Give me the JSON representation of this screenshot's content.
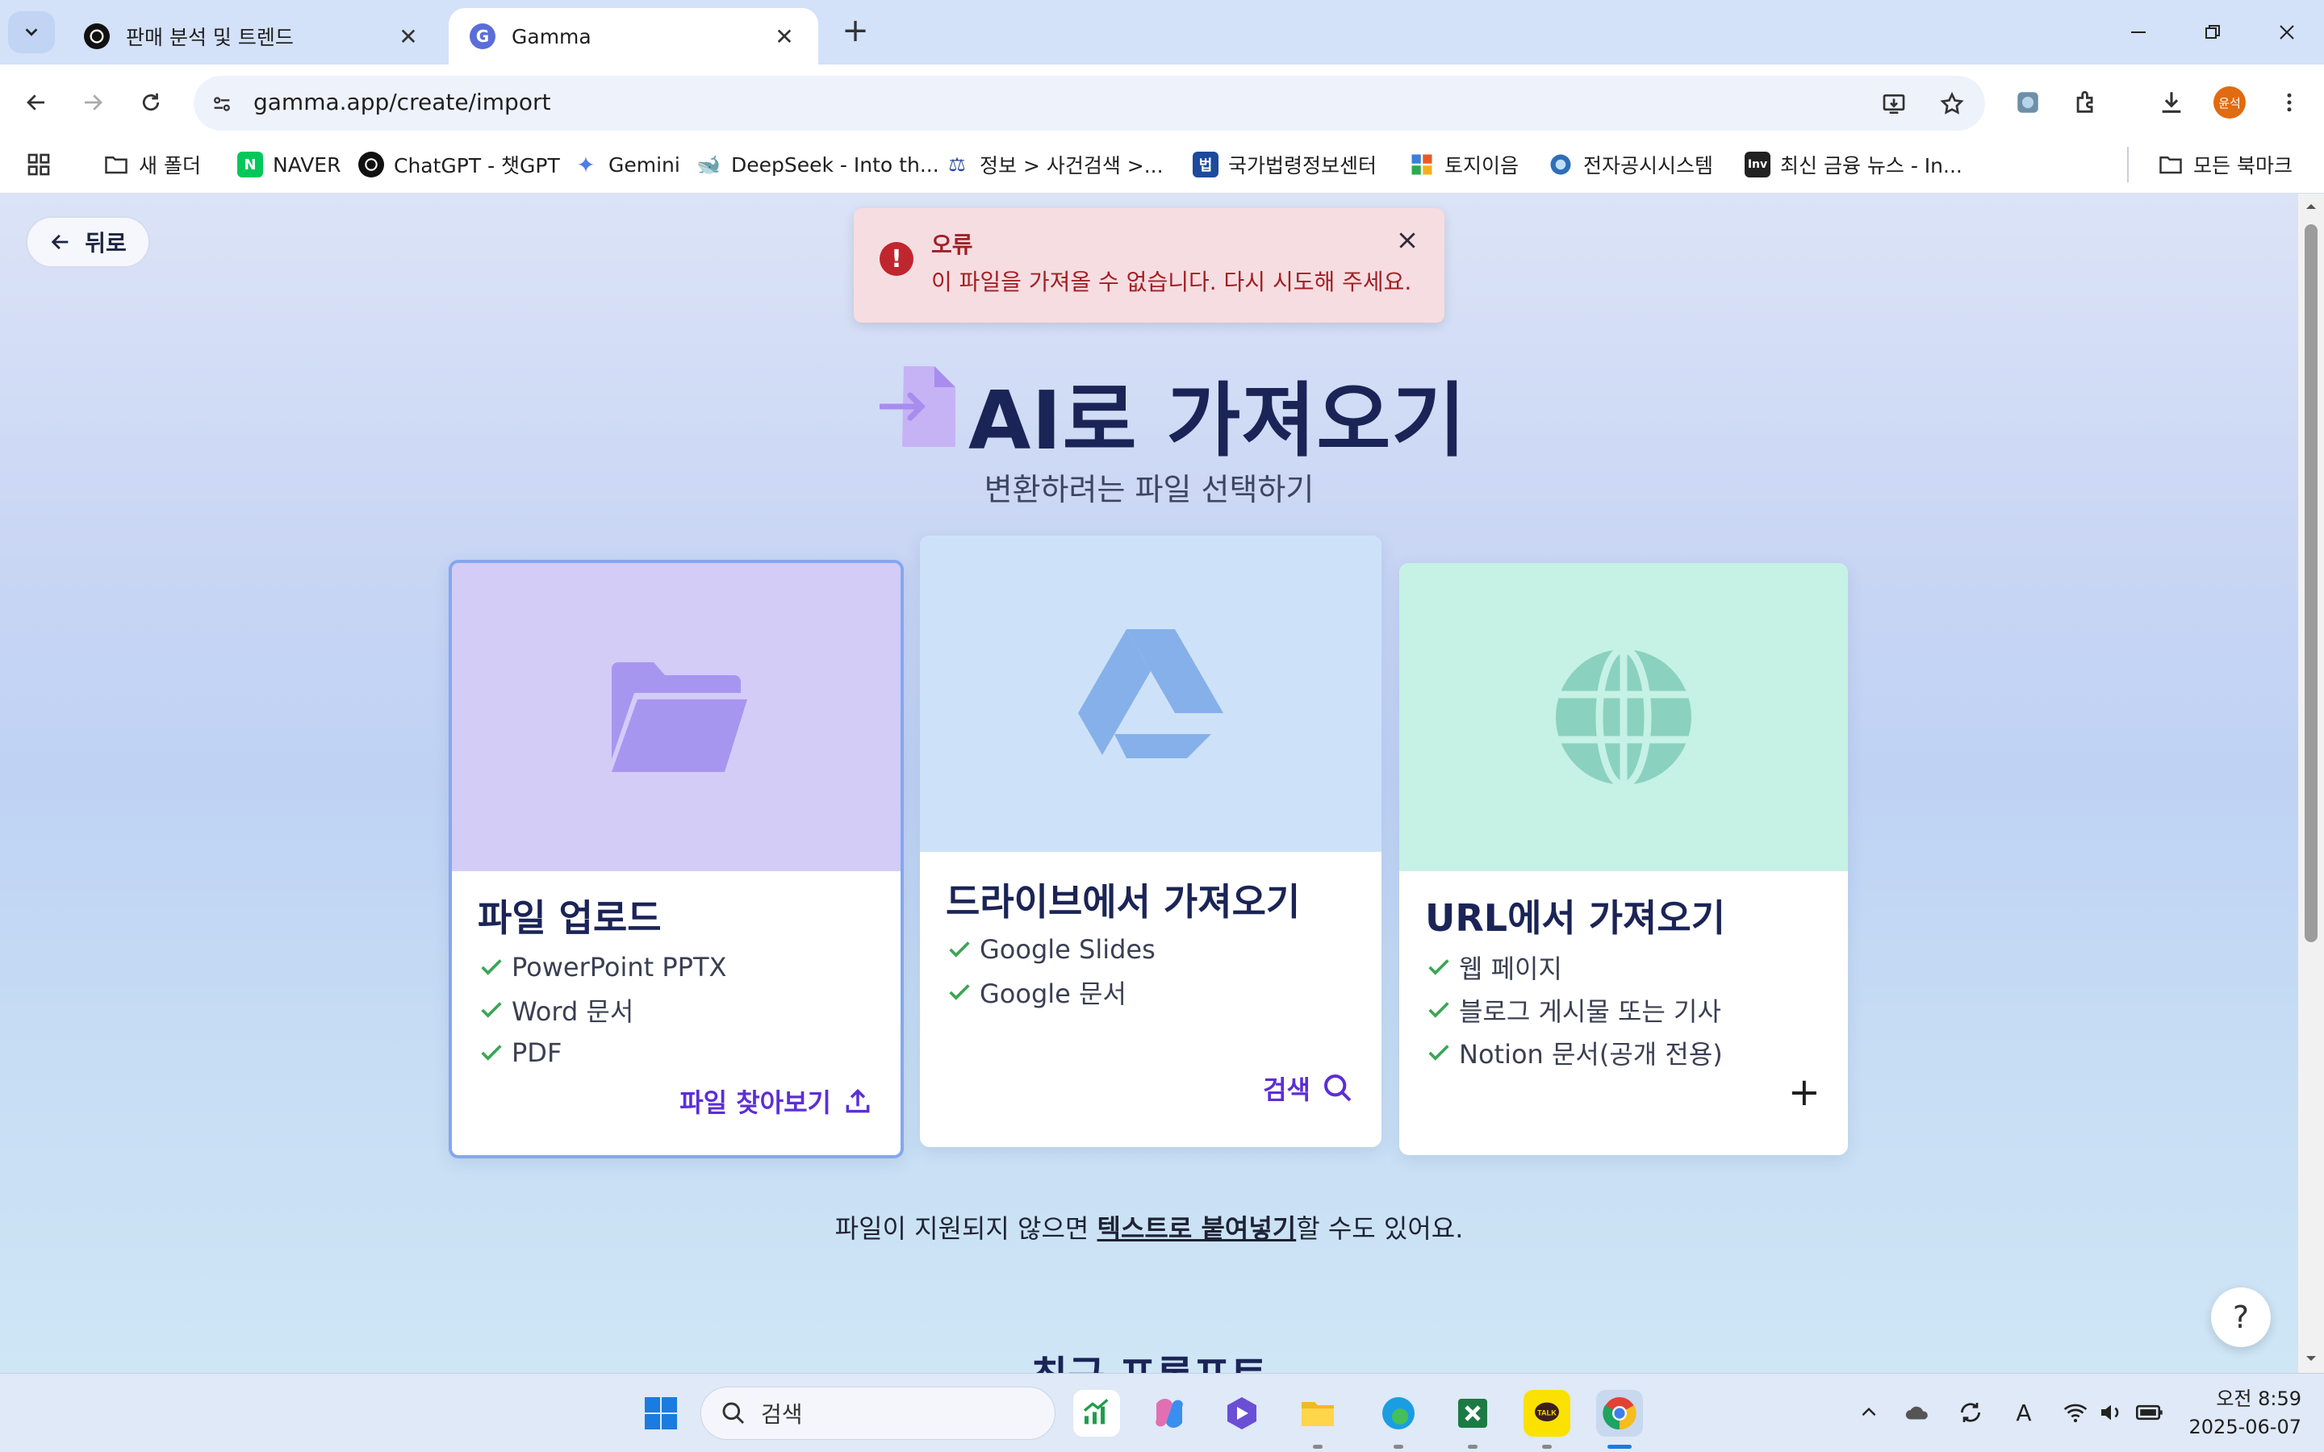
{
  "browser": {
    "tabs": [
      {
        "title": "판매 분석 및 트렌드",
        "active": false
      },
      {
        "title": "Gamma",
        "active": true
      }
    ],
    "url": "gamma.app/create/import",
    "profile_initials": "윤석",
    "bookmarks": [
      {
        "label": "새 폴더",
        "icon": "folder-icon"
      },
      {
        "label": "NAVER",
        "icon": "naver-icon"
      },
      {
        "label": "ChatGPT - 챗GPT",
        "icon": "chatgpt-icon"
      },
      {
        "label": "Gemini",
        "icon": "gemini-icon"
      },
      {
        "label": "DeepSeek - Into th...",
        "icon": "deepseek-icon"
      },
      {
        "label": "정보 > 사건검색 >...",
        "icon": "court-icon"
      },
      {
        "label": "국가법령정보센터",
        "icon": "law-icon"
      },
      {
        "label": "토지이음",
        "icon": "land-icon"
      },
      {
        "label": "전자공시시스템",
        "icon": "dart-icon"
      },
      {
        "label": "최신 금융 뉴스 - In...",
        "icon": "investing-icon"
      }
    ],
    "all_bookmarks": "모든 북마크"
  },
  "page": {
    "back_label": "뒤로",
    "error": {
      "title": "오류",
      "message": "이 파일을 가져올 수 없습니다. 다시 시도해 주세요."
    },
    "title": "AI로 가져오기",
    "subtitle": "변환하려는 파일 선택하기",
    "cards": {
      "upload": {
        "title": "파일 업로드",
        "items": [
          "PowerPoint PPTX",
          "Word 문서",
          "PDF"
        ],
        "action": "파일 찾아보기",
        "color": "#d3ccf7"
      },
      "drive": {
        "title": "드라이브에서 가져오기",
        "items": [
          "Google Slides",
          "Google 문서"
        ],
        "action": "검색",
        "color": "#cde2f8"
      },
      "url": {
        "title": "URL에서 가져오기",
        "items": [
          "웹 페이지",
          "블로그 게시물 또는 기사",
          "Notion 문서(공개 전용)"
        ],
        "action": "+",
        "color": "#c6f1e5"
      }
    },
    "footnote_before": "파일이 지원되지 않으면 ",
    "footnote_link": "텍스트로 붙여넣기",
    "footnote_after": "할 수도 있어요.",
    "recent_heading": "최근 프롬프트",
    "help": "?"
  },
  "taskbar": {
    "search_placeholder": "검색",
    "time": "오전 8:59",
    "date": "2025-06-07",
    "ime": "A"
  },
  "colors": {
    "accent": "#5b2fd6",
    "check": "#3aa655",
    "error": "#c0262d"
  }
}
